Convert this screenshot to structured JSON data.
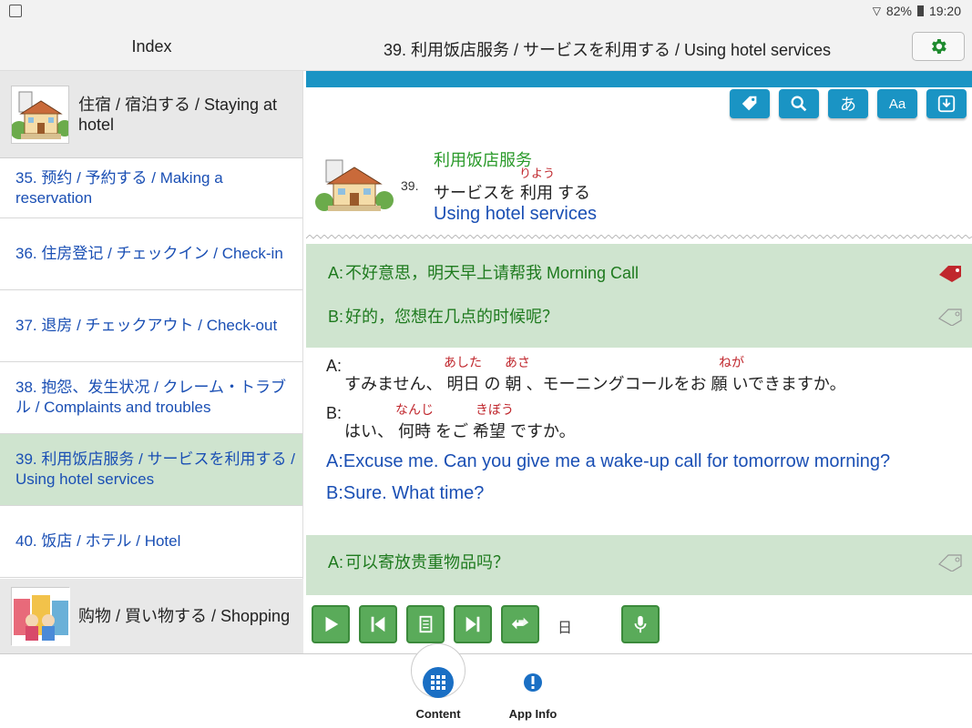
{
  "status": {
    "battery": "82%",
    "time": "19:20"
  },
  "topbar": {
    "index_label": "Index",
    "title": "39. 利用饭店服务 / サービスを利用する / Using hotel services"
  },
  "sidebar": {
    "category": "住宿 / 宿泊する / Staying at hotel",
    "items": [
      {
        "label": "35. 预约 / 予約する / Making a reservation"
      },
      {
        "label": "36. 住房登记 / チェックイン / Check-in"
      },
      {
        "label": "37. 退房 / チェックアウト / Check-out"
      },
      {
        "label": "38. 抱怨、发生状况 / クレーム・トラブル / Complaints and troubles"
      },
      {
        "label": "39. 利用饭店服务 / サービスを利用する / Using hotel services"
      },
      {
        "label": "40. 饭店 / ホテル / Hotel"
      }
    ],
    "next_category": "购物 / 買い物する / Shopping"
  },
  "toolbar": {
    "kana_label": "あ",
    "font_label": "Aa"
  },
  "lesson": {
    "number": "39.",
    "zh": "利用饭店服务",
    "ja": "サービスを 利用 する",
    "ja_ruby": "りよう",
    "en": "Using hotel services"
  },
  "dialog1": {
    "a_label": "A:",
    "a_text": "不好意思，明天早上请帮我 Morning Call",
    "b_label": "B:",
    "b_text": "好的，您想在几点的时候呢？"
  },
  "japanese": {
    "a_label": "A:",
    "a_text": "すみません、 明日 の 朝 、モーニングコールをお 願 いできますか。",
    "a_ruby1": "あした",
    "a_ruby2": "あさ",
    "a_ruby3": "ねが",
    "b_label": "B:",
    "b_text": "はい、 何時 をご 希望 ですか。",
    "b_ruby1": "なんじ",
    "b_ruby2": "きぼう"
  },
  "english": {
    "a_text": "A:Excuse me. Can you give me a wake-up call for tomorrow morning?",
    "b_text": "B:Sure. What time?"
  },
  "dialog2": {
    "a_label": "A:",
    "a_text": "可以寄放贵重物品吗？"
  },
  "player": {
    "mode_label": "日"
  },
  "bottomnav": {
    "content_label": "Content",
    "appinfo_label": "App Info"
  }
}
